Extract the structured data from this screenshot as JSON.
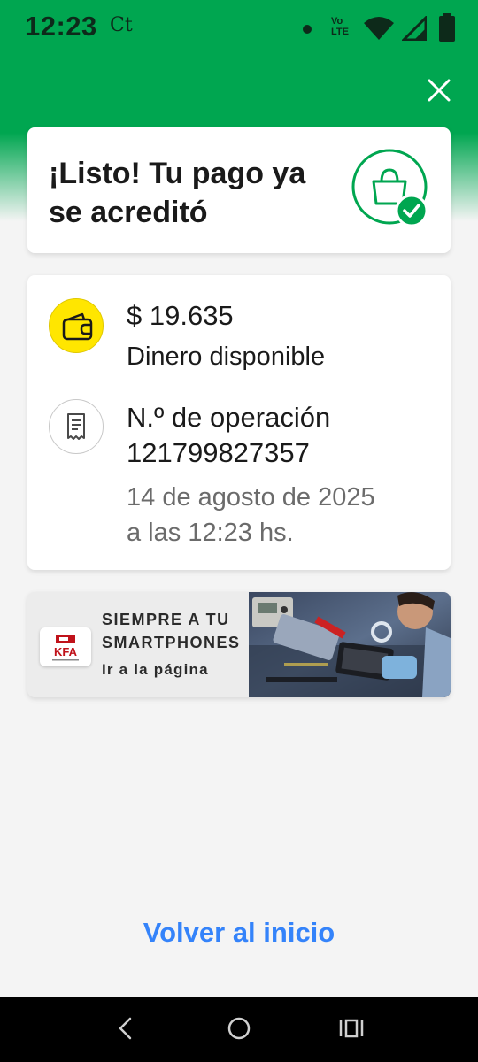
{
  "status_bar": {
    "time": "12:23",
    "carrier": "Ct",
    "network_badge_line1": "Vo",
    "network_badge_line2": "LTE",
    "icons": [
      "dot-icon",
      "wifi-icon",
      "signal-icon",
      "battery-icon"
    ]
  },
  "header": {
    "close_icon": "close-icon",
    "accent_color": "#00a650"
  },
  "success": {
    "title": "¡Listo! Tu pago ya se acreditó",
    "icon": "shopping-bag-check-icon",
    "icon_color": "#00a650"
  },
  "details": {
    "amount": "$ 19.635",
    "amount_label": "Dinero disponible",
    "wallet_icon": "wallet-icon",
    "wallet_color": "#ffe600",
    "receipt_icon": "receipt-icon",
    "operation_label": "N.º de operación",
    "operation_number": "121799827357",
    "date_line1": "14 de agosto de 2025",
    "date_line2": "a las 12:23 hs."
  },
  "ad": {
    "logo_text": "KFA",
    "title": "SIEMPRE A TU SMARTPHONES DE",
    "link": "Ir a la página",
    "image": "technician-repairing-phone"
  },
  "actions": {
    "back_home": "Volver al inicio",
    "link_color": "#3483fa"
  },
  "nav_bar": {
    "icons": [
      "back-icon",
      "home-icon",
      "recent-apps-icon"
    ]
  }
}
